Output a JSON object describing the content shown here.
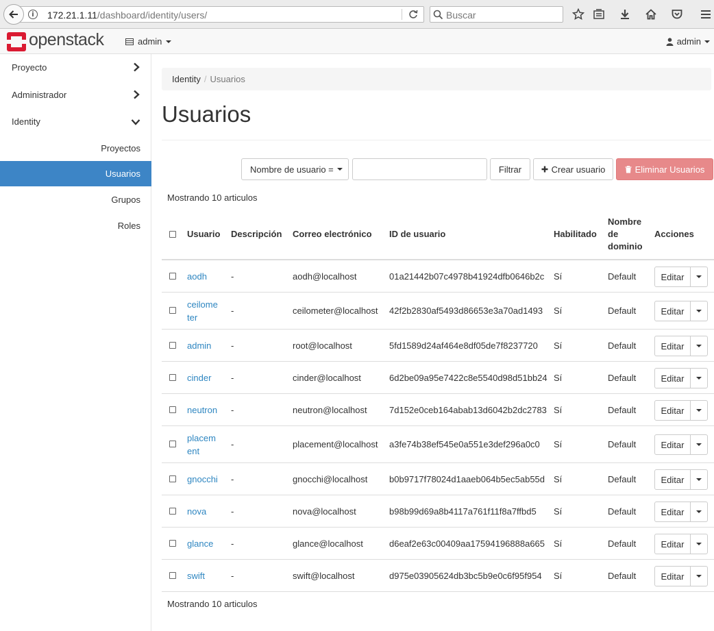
{
  "browser": {
    "url_host": "172.21.1.11",
    "url_path": "/dashboard/identity/users/",
    "search_placeholder": "Buscar"
  },
  "navbar": {
    "logo_text": "openstack",
    "project": "admin",
    "user": "admin"
  },
  "sidebar": {
    "panels": [
      {
        "label": "Proyecto",
        "expanded": false
      },
      {
        "label": "Administrador",
        "expanded": false
      },
      {
        "label": "Identity",
        "expanded": true
      }
    ],
    "items": [
      {
        "label": "Proyectos",
        "active": false
      },
      {
        "label": "Usuarios",
        "active": true
      },
      {
        "label": "Grupos",
        "active": false
      },
      {
        "label": "Roles",
        "active": false
      }
    ]
  },
  "breadcrumb": {
    "root": "Identity",
    "current": "Usuarios"
  },
  "page_title": "Usuarios",
  "filter": {
    "field_label": "Nombre de usuario =",
    "input_value": "",
    "filter_button": "Filtrar",
    "create_button": "Crear usuario",
    "delete_button": "Eliminar Usuarios"
  },
  "count_text": "Mostrando 10 articulos",
  "table": {
    "headers": {
      "user": "Usuario",
      "description": "Descripción",
      "email": "Correo electrónico",
      "id": "ID de usuario",
      "enabled": "Habilitado",
      "domain_line1": "Nombre",
      "domain_line2": "de",
      "domain_line3": "dominio",
      "actions": "Acciones"
    },
    "edit_label": "Editar",
    "rows": [
      {
        "name": "aodh",
        "name_l2": "",
        "description": "-",
        "email": "aodh@localhost",
        "id": "01a21442b07c4978b41924dfb0646b2c",
        "enabled": "Sí",
        "domain": "Default"
      },
      {
        "name": "ceilome",
        "name_l2": "ter",
        "description": "-",
        "email": "ceilometer@localhost",
        "id": "42f2b2830af5493d86653e3a70ad1493",
        "enabled": "Sí",
        "domain": "Default"
      },
      {
        "name": "admin",
        "name_l2": "",
        "description": "-",
        "email": "root@localhost",
        "id": "5fd1589d24af464e8df05de7f8237720",
        "enabled": "Sí",
        "domain": "Default"
      },
      {
        "name": "cinder",
        "name_l2": "",
        "description": "-",
        "email": "cinder@localhost",
        "id": "6d2be09a95e7422c8e5540d98d51bb24",
        "enabled": "Sí",
        "domain": "Default"
      },
      {
        "name": "neutron",
        "name_l2": "",
        "description": "-",
        "email": "neutron@localhost",
        "id": "7d152e0ceb164abab13d6042b2dc2783",
        "enabled": "Sí",
        "domain": "Default"
      },
      {
        "name": "placem",
        "name_l2": "ent",
        "description": "-",
        "email": "placement@localhost",
        "id": "a3fe74b38ef545e0a551e3def296a0c0",
        "enabled": "Sí",
        "domain": "Default"
      },
      {
        "name": "gnocchi",
        "name_l2": "",
        "description": "-",
        "email": "gnocchi@localhost",
        "id": "b0b9717f78024d1aaeb064b5ec5ab55d",
        "enabled": "Sí",
        "domain": "Default"
      },
      {
        "name": "nova",
        "name_l2": "",
        "description": "-",
        "email": "nova@localhost",
        "id": "b98b99d69a8b4117a761f11f8a7ffbd5",
        "enabled": "Sí",
        "domain": "Default"
      },
      {
        "name": "glance",
        "name_l2": "",
        "description": "-",
        "email": "glance@localhost",
        "id": "d6eaf2e63c00409aa17594196888a665",
        "enabled": "Sí",
        "domain": "Default"
      },
      {
        "name": "swift",
        "name_l2": "",
        "description": "-",
        "email": "swift@localhost",
        "id": "d975e03905624db3bc5b9e0c6f95f954",
        "enabled": "Sí",
        "domain": "Default"
      }
    ]
  },
  "colors": {
    "accent": "#3d85c6",
    "link": "#2e86c1",
    "danger": "#e7898a",
    "logo_red": "#da1a32"
  }
}
